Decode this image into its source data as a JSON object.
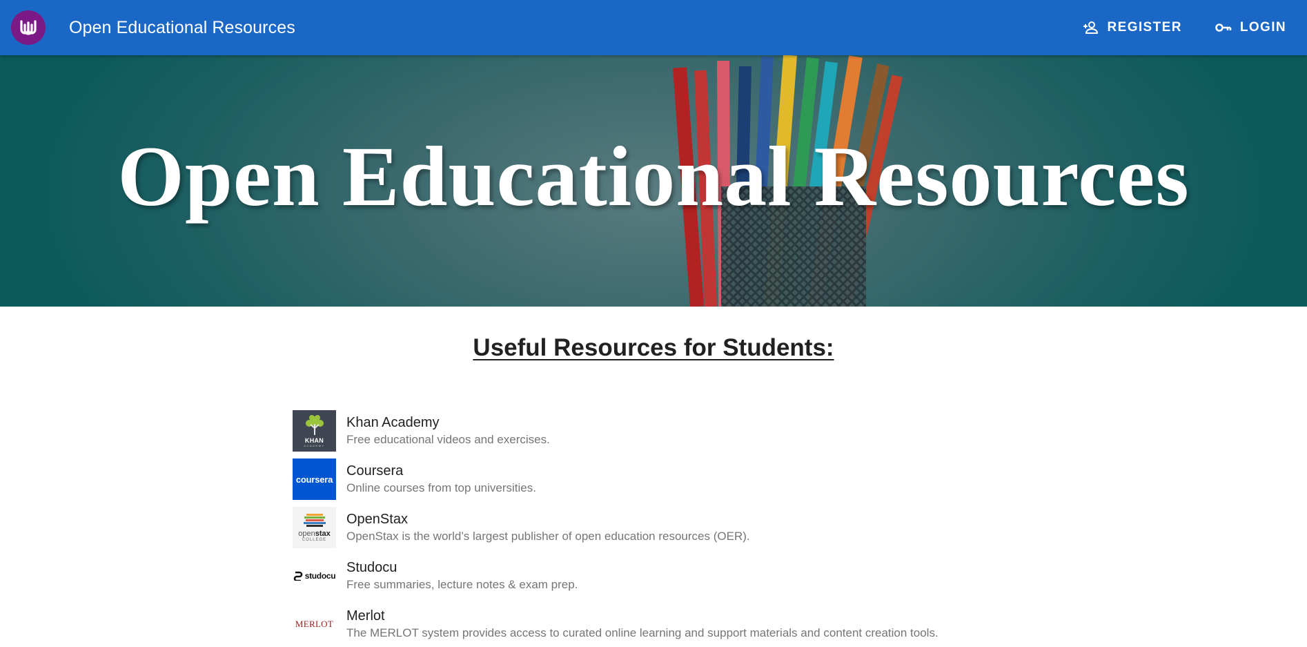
{
  "header": {
    "title": "Open Educational Resources",
    "register_label": "REGISTER",
    "login_label": "LOGIN"
  },
  "hero": {
    "title": "Open Educational Resources"
  },
  "section": {
    "title": "Useful Resources for Students:"
  },
  "resources": [
    {
      "name": "Khan Academy",
      "description": "Free educational videos and exercises.",
      "logo_text": "KHAN",
      "logo_subtext": "ACADEMY"
    },
    {
      "name": "Coursera",
      "description": "Online courses from top universities.",
      "logo_text": "coursera"
    },
    {
      "name": "OpenStax",
      "description": "OpenStax is the world’s largest publisher of open education resources (OER).",
      "logo_text_a": "open",
      "logo_text_b": "stax",
      "logo_subtext": "COLLEGE"
    },
    {
      "name": "Studocu",
      "description": "Free summaries, lecture notes & exam prep.",
      "logo_text": "studocu"
    },
    {
      "name": "Merlot",
      "description": "The MERLOT system provides access to curated online learning and support materials and content creation tools.",
      "logo_text": "MERLOT"
    }
  ],
  "colors": {
    "app_bar": "#1a67c5",
    "logo_circle": "#7b1a86",
    "hero_teal": "#0b5a5c",
    "secondary_text": "#757575"
  },
  "icons": {
    "register": "person-add-icon",
    "login": "key-icon",
    "logo": "university-logo-icon"
  }
}
